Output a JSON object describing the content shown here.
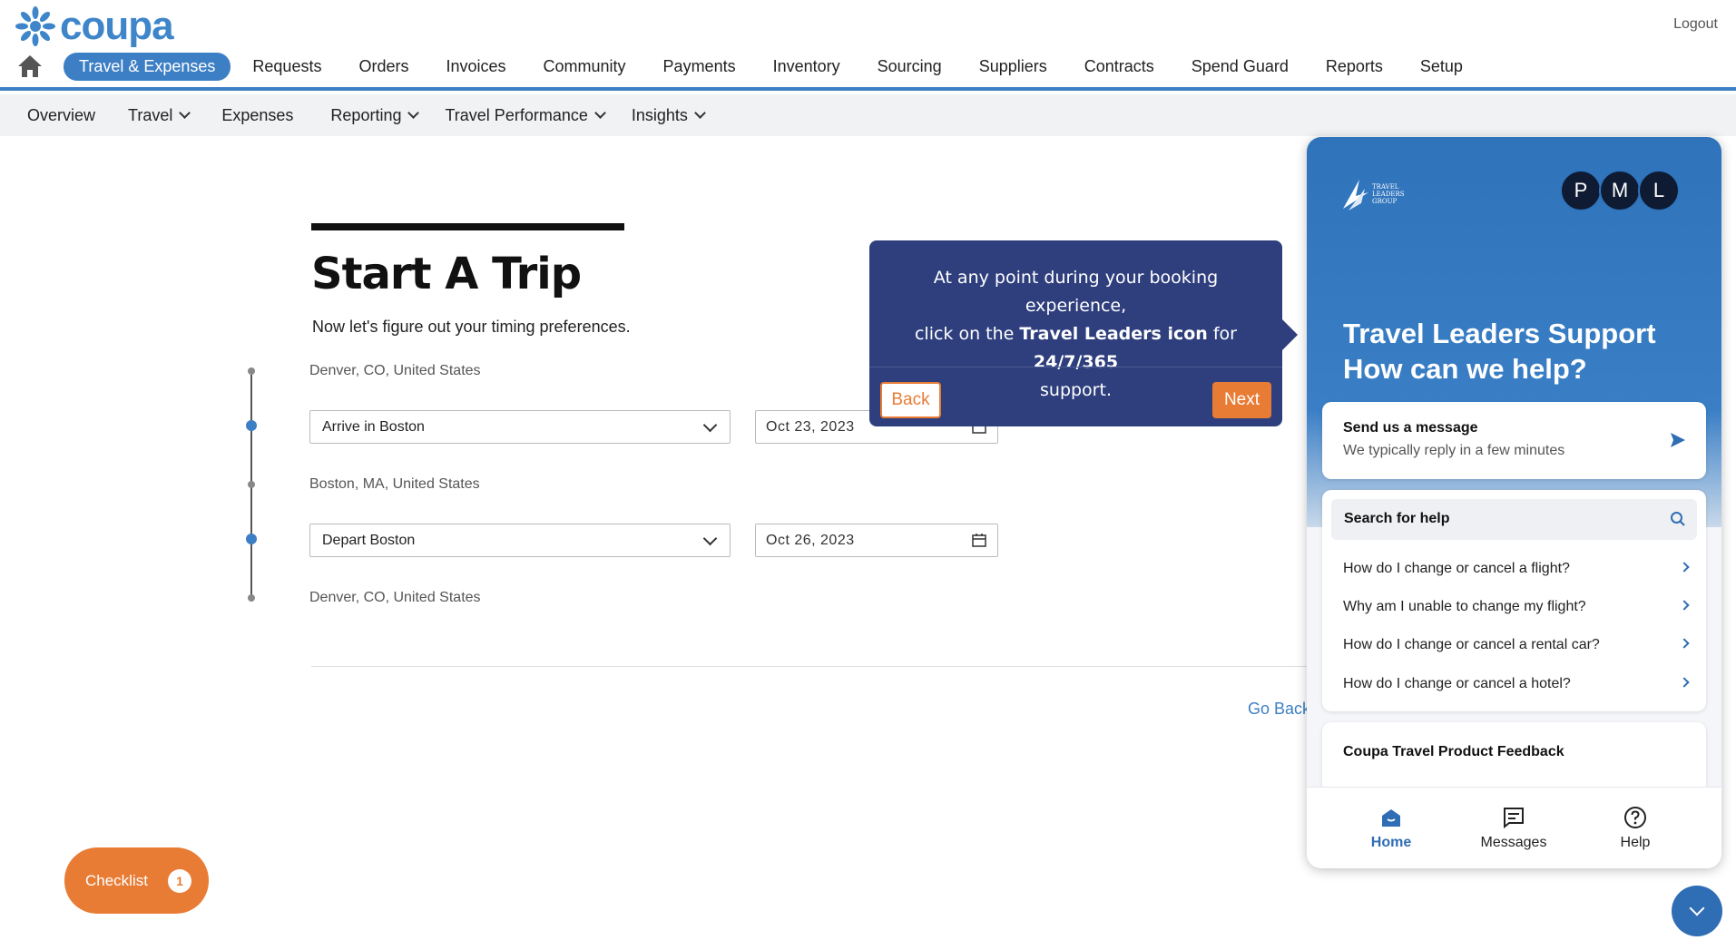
{
  "app": {
    "logo_text": "coupa",
    "logout_label": "Logout"
  },
  "main_nav": {
    "active": "Travel & Expenses",
    "items": [
      "Requests",
      "Orders",
      "Invoices",
      "Community",
      "Payments",
      "Inventory",
      "Sourcing",
      "Suppliers",
      "Contracts",
      "Spend Guard",
      "Reports",
      "Setup"
    ]
  },
  "sub_nav": {
    "overview": "Overview",
    "travel": "Travel",
    "expenses": "Expenses",
    "reporting": "Reporting",
    "travel_performance": "Travel Performance",
    "insights": "Insights"
  },
  "trip": {
    "title": "Start A Trip",
    "subtitle": "Now let's figure out your timing preferences.",
    "origin": "Denver, CO, United States",
    "arrive_select": "Arrive in Boston",
    "arrive_date": "Oct 23, 2023",
    "destination": "Boston, MA, United States",
    "depart_select": "Depart Boston",
    "depart_date": "Oct 26, 2023",
    "return": "Denver, CO, United States",
    "go_back": "Go Back"
  },
  "checklist": {
    "label": "Checklist",
    "count": "1"
  },
  "tooltip": {
    "line1": "At any point during your booking experience,",
    "line2_pre": "click on the ",
    "line2_bold1": "Travel Leaders icon",
    "line2_mid": " for ",
    "line2_bold2": "24/7/365",
    "line3": "support.",
    "back_label": "Back",
    "next_label": "Next"
  },
  "widget": {
    "avatars": [
      "P",
      "M",
      "L"
    ],
    "heading1": "Travel Leaders Support",
    "heading2": "How can we help?",
    "message_title": "Send us a message",
    "message_sub": "We typically reply in a few minutes",
    "search_label": "Search for help",
    "faqs": [
      "How do I change or cancel a flight?",
      "Why am I unable to change my flight?",
      "How do I change or cancel a rental car?",
      "How do I change or cancel a hotel?"
    ],
    "feedback_title": "Coupa Travel Product Feedback",
    "tabs": {
      "home": "Home",
      "messages": "Messages",
      "help": "Help"
    }
  },
  "colors": {
    "brand_blue": "#3d7fc4",
    "accent_orange": "#e87c35",
    "tooltip_bg": "#2f3f7d"
  }
}
